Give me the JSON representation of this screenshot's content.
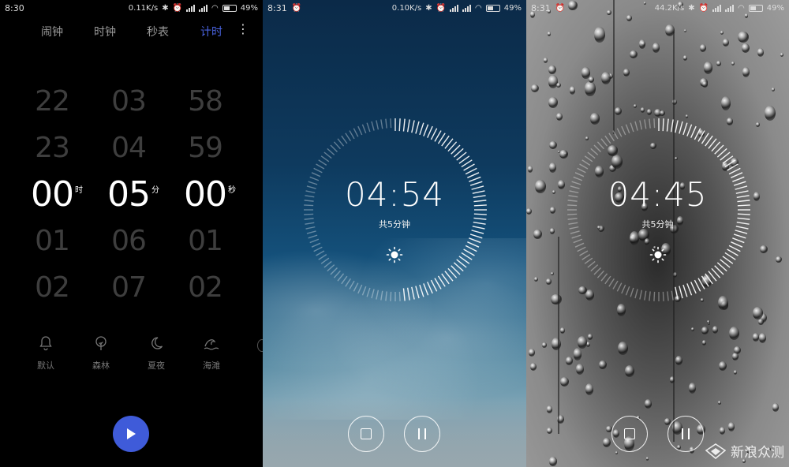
{
  "panels": [
    {
      "status": {
        "time": "8:30",
        "speed": "0.11K/s",
        "battery": "49%"
      },
      "tabs": [
        {
          "label": "闹钟",
          "active": false
        },
        {
          "label": "时钟",
          "active": false
        },
        {
          "label": "秒表",
          "active": false
        },
        {
          "label": "计时",
          "active": true
        }
      ],
      "picker": {
        "hours": [
          "22",
          "23",
          "00",
          "01",
          "02"
        ],
        "minutes": [
          "03",
          "04",
          "05",
          "06",
          "07"
        ],
        "seconds": [
          "58",
          "59",
          "00",
          "01",
          "02"
        ],
        "hour_unit": "时",
        "minute_unit": "分",
        "second_unit": "秒"
      },
      "sounds": [
        {
          "label": "默认",
          "icon": "bell-icon"
        },
        {
          "label": "森林",
          "icon": "tree-icon"
        },
        {
          "label": "夏夜",
          "icon": "moon-icon"
        },
        {
          "label": "海滩",
          "icon": "wave-icon"
        }
      ],
      "accent": "#3f5bd9"
    },
    {
      "status": {
        "time": "8:31",
        "speed": "0.10K/s",
        "battery": "49%"
      },
      "countdown": "04:54",
      "total_label": "共5分钟",
      "progress": 0.98
    },
    {
      "status": {
        "time": "8:31",
        "speed": "44.2K/s",
        "battery": "49%"
      },
      "countdown": "04:45",
      "total_label": "共5分钟",
      "progress": 0.95
    }
  ],
  "watermark": "新浪众测"
}
